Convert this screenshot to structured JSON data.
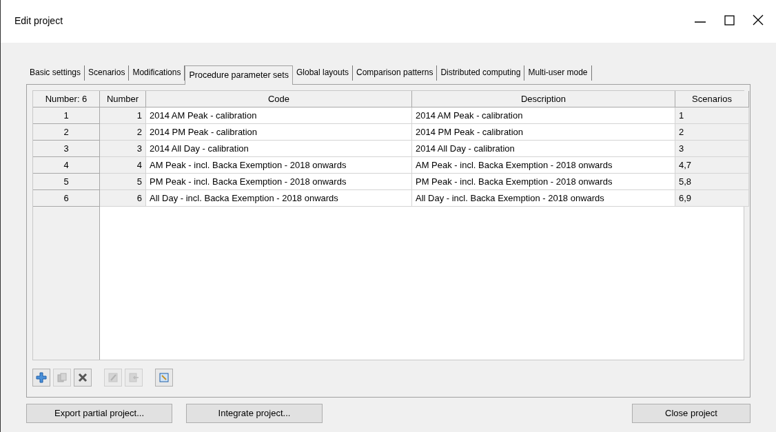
{
  "window": {
    "title": "Edit project"
  },
  "tabs": [
    {
      "label": "Basic settings",
      "selected": false
    },
    {
      "label": "Scenarios",
      "selected": false
    },
    {
      "label": "Modifications",
      "selected": false
    },
    {
      "label": "Procedure parameter sets",
      "selected": true
    },
    {
      "label": "Global layouts",
      "selected": false
    },
    {
      "label": "Comparison patterns",
      "selected": false
    },
    {
      "label": "Distributed computing",
      "selected": false
    },
    {
      "label": "Multi-user mode",
      "selected": false
    }
  ],
  "table": {
    "corner": "Number: 6",
    "columns": [
      "Number",
      "Code",
      "Description",
      "Scenarios"
    ],
    "rows": [
      {
        "header": "1",
        "cells": [
          "1",
          "2014 AM Peak - calibration",
          "2014 AM Peak - calibration",
          "1"
        ]
      },
      {
        "header": "2",
        "cells": [
          "2",
          "2014 PM Peak - calibration",
          "2014 PM Peak - calibration",
          "2"
        ]
      },
      {
        "header": "3",
        "cells": [
          "3",
          "2014 All Day - calibration",
          "2014 All Day - calibration",
          "3"
        ]
      },
      {
        "header": "4",
        "cells": [
          "4",
          "AM Peak - incl. Backa Exemption - 2018 onwards",
          "AM Peak - incl. Backa Exemption - 2018 onwards",
          "4,7"
        ]
      },
      {
        "header": "5",
        "cells": [
          "5",
          "PM Peak - incl. Backa Exemption - 2018 onwards",
          "PM Peak - incl. Backa Exemption - 2018 onwards",
          "5,8"
        ]
      },
      {
        "header": "6",
        "cells": [
          "6",
          "All Day - incl. Backa Exemption - 2018 onwards",
          "All Day - incl. Backa Exemption - 2018 onwards",
          "6,9"
        ]
      }
    ]
  },
  "toolbar": [
    {
      "kind": "add",
      "disabled": false
    },
    {
      "kind": "copy",
      "disabled": true
    },
    {
      "kind": "delete",
      "disabled": false
    },
    {
      "kind": "edit",
      "disabled": true
    },
    {
      "kind": "import",
      "disabled": true
    },
    {
      "kind": "zoom",
      "disabled": false
    }
  ],
  "buttons": [
    {
      "label": "Export partial project..."
    },
    {
      "label": "Integrate project..."
    },
    {
      "label": "Close project"
    }
  ]
}
